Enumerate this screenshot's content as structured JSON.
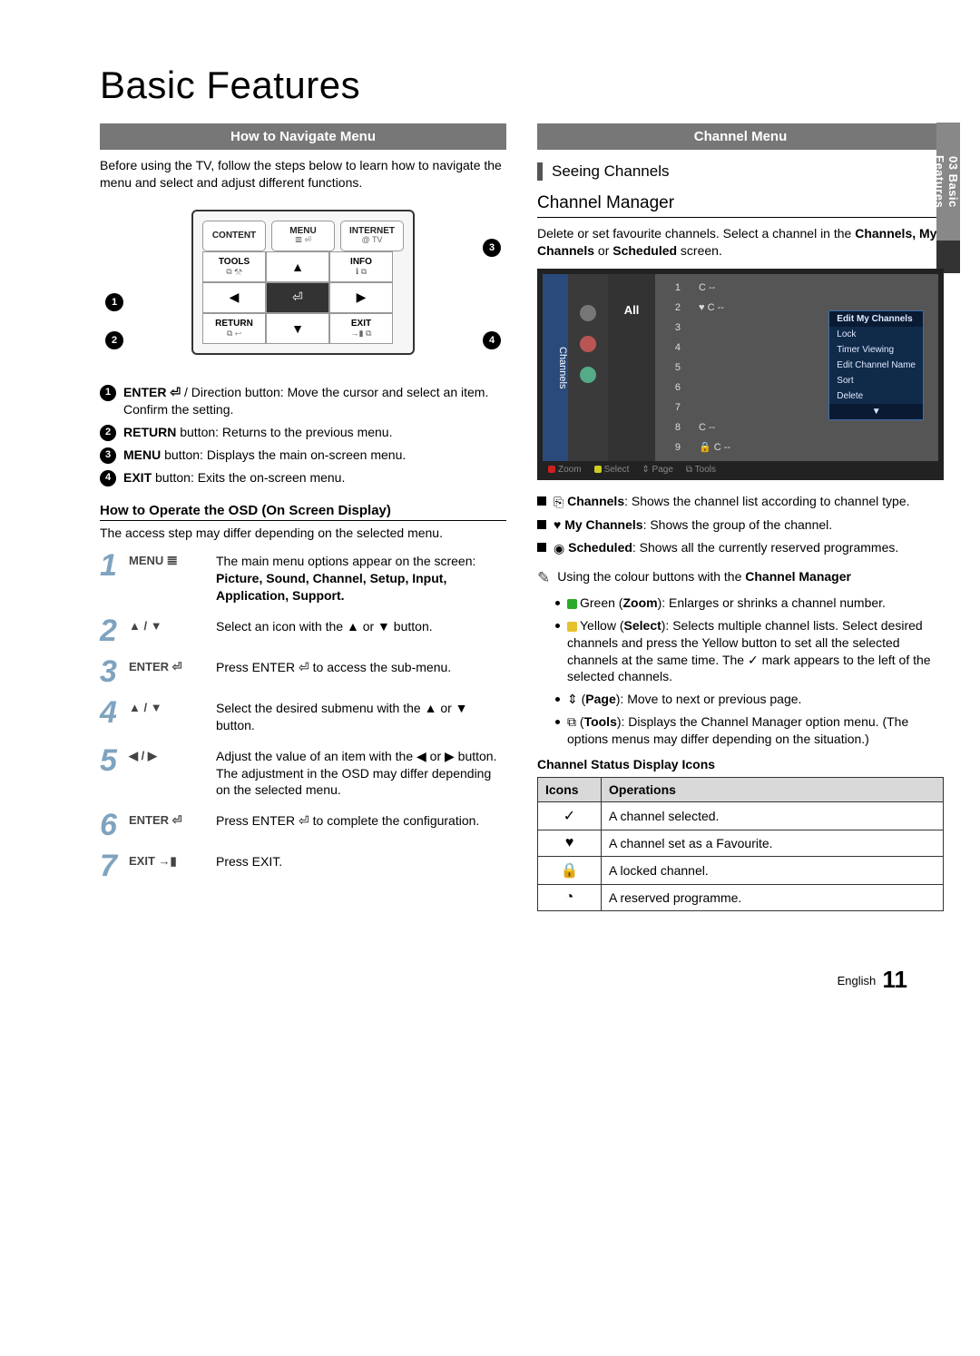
{
  "page": {
    "title": "Basic Features",
    "sidebar_label": "03  Basic Features",
    "footer_lang": "English",
    "footer_page": "11"
  },
  "left": {
    "bar": "How to Navigate Menu",
    "intro": "Before using the TV, follow the steps below to learn how to navigate the menu and select and adjust different functions.",
    "remote": {
      "r1c1": "CONTENT",
      "r1c2_top": "MENU",
      "r1c2_sub": "𝌆 ⏎",
      "r1c3_top": "INTERNET",
      "r1c3_sub": "@ TV",
      "r2c1_top": "TOOLS",
      "r2c1_sub": "⧉ ⚒",
      "r2c2": "▲",
      "r2c3_top": "INFO",
      "r2c3_sub": "ℹ ⧉",
      "r3c1": "◀",
      "r3c2": "⏎",
      "r3c3": "▶",
      "r4c1_top": "RETURN",
      "r4c1_sub": "⧉ ↩",
      "r4c2": "▼",
      "r4c3_top": "EXIT",
      "r4c3_sub": "→▮ ⧉"
    },
    "callouts": {
      "c1": "1",
      "c2": "2",
      "c3": "3",
      "c4": "4"
    },
    "list": [
      {
        "n": "1",
        "text_pre": "ENTER ⏎",
        "text": " / Direction button: Move the cursor and select an item. Confirm the setting."
      },
      {
        "n": "2",
        "text_pre": "RETURN",
        "text": " button: Returns to the previous menu."
      },
      {
        "n": "3",
        "text_pre": "MENU",
        "text": " button: Displays the main on-screen menu."
      },
      {
        "n": "4",
        "text_pre": "EXIT",
        "text": " button: Exits the on-screen menu."
      }
    ],
    "osd_head": "How to Operate the OSD (On Screen Display)",
    "osd_desc": "The access step may differ depending on the selected menu.",
    "osd": [
      {
        "step": "1",
        "btn": "MENU 𝌆",
        "text": "The main menu options appear on the screen:",
        "text2": "Picture, Sound, Channel, Setup, Input, Application, Support."
      },
      {
        "step": "2",
        "btn": "▲ / ▼",
        "text": "Select an icon with the ▲ or ▼ button."
      },
      {
        "step": "3",
        "btn": "ENTER ⏎",
        "text": "Press ENTER ⏎ to access the sub-menu."
      },
      {
        "step": "4",
        "btn": "▲ / ▼",
        "text": "Select the desired submenu with the ▲ or ▼ button."
      },
      {
        "step": "5",
        "btn": "◀ / ▶",
        "text": "Adjust the value of an item with the ◀ or ▶ button. The adjustment in the OSD may differ depending on the selected menu."
      },
      {
        "step": "6",
        "btn": "ENTER ⏎",
        "text": "Press ENTER ⏎ to complete the configuration."
      },
      {
        "step": "7",
        "btn": "EXIT →▮",
        "text": "Press EXIT."
      }
    ]
  },
  "right": {
    "bar": "Channel Menu",
    "seeing": "Seeing Channels",
    "cm_head": "Channel Manager",
    "cm_desc1": "Delete or set favourite channels. Select a channel in the ",
    "cm_desc2": "Channels, My Channels",
    "cm_desc3": " or ",
    "cm_desc4": "Scheduled",
    "cm_desc5": " screen.",
    "screen": {
      "tab": "Channels",
      "all": "All",
      "rows": [
        {
          "n": "1",
          "t": "C --"
        },
        {
          "n": "2",
          "t": "♥ C --"
        },
        {
          "n": "3",
          "t": ""
        },
        {
          "n": "4",
          "t": ""
        },
        {
          "n": "5",
          "t": ""
        },
        {
          "n": "6",
          "t": ""
        },
        {
          "n": "7",
          "t": ""
        },
        {
          "n": "8",
          "t": "C --"
        },
        {
          "n": "9",
          "t": "🔒 C --"
        }
      ],
      "menu_title": "Edit My Channels",
      "menu_items": [
        "Lock",
        "Timer Viewing",
        "Edit Channel Name",
        "Sort",
        "Delete"
      ],
      "foot_zoom": "Zoom",
      "foot_select": "Select",
      "foot_page": "Page",
      "foot_tools": "Tools"
    },
    "boxes": [
      {
        "icon": "⎘",
        "label": "Channels",
        "text": ": Shows the channel list according to channel type."
      },
      {
        "icon": "♥",
        "label": "My Channels",
        "text": ": Shows the group of the channel."
      },
      {
        "icon": "◉",
        "label": "Scheduled",
        "text": ": Shows all the currently reserved programmes."
      }
    ],
    "note_head": "Using the colour buttons with the ",
    "note_head_bold": "Channel Manager",
    "colours": [
      {
        "box": "#2aaa2a",
        "pre": "Green (",
        "label": "Zoom",
        "post": "): Enlarges or shrinks a channel number."
      },
      {
        "box": "#e6c22a",
        "pre": "Yellow (",
        "label": "Select",
        "post": "): Selects multiple channel lists. Select desired channels and press the Yellow button to set all the selected channels at the same time. The ✓ mark appears to the left of the selected channels."
      },
      {
        "box": "",
        "icon": "⇕",
        "pre": "(",
        "label": "Page",
        "post": "): Move to next or previous page."
      },
      {
        "box": "",
        "icon": "⧉",
        "pre": "(",
        "label": "Tools",
        "post": "): Displays the Channel Manager option menu. (The options menus may differ depending on the situation.)"
      }
    ],
    "icons_head": "Channel Status Display Icons",
    "th_icons": "Icons",
    "th_ops": "Operations",
    "iconrows": [
      {
        "i": "✓",
        "t": "A channel selected."
      },
      {
        "i": "♥",
        "t": "A channel set as a Favourite."
      },
      {
        "i": "🔒",
        "t": "A locked channel."
      },
      {
        "i": "◔",
        "t": "A reserved programme."
      }
    ]
  }
}
